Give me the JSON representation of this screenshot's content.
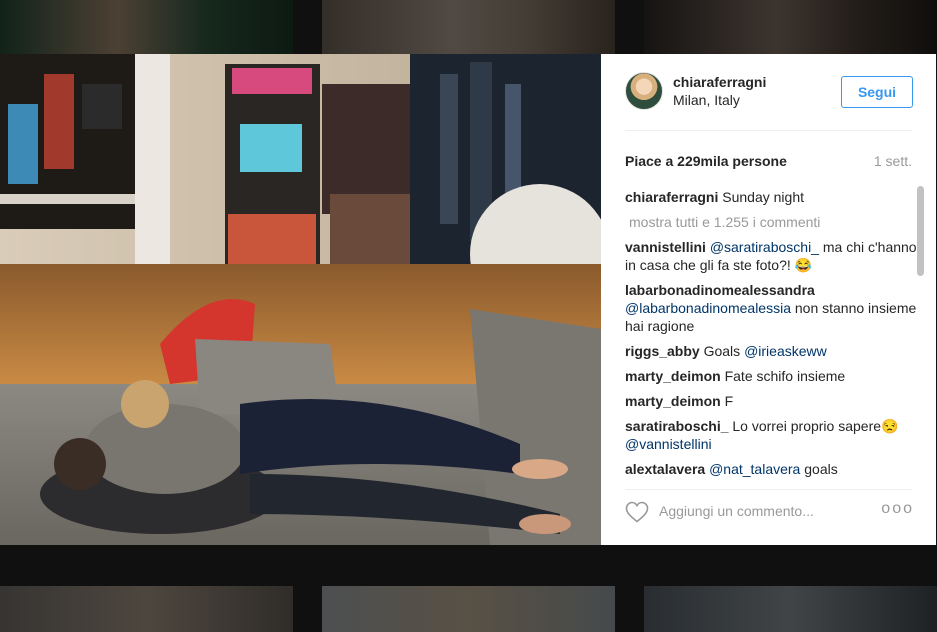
{
  "post": {
    "username": "chiaraferragni",
    "location": "Milan, Italy",
    "follow_label": "Segui",
    "likes": "Piace a 229mila persone",
    "time_ago": "1 sett.",
    "caption_user": "chiaraferragni",
    "caption_text": "Sunday night",
    "view_all": "mostra tutti e 1.255 i commenti",
    "add_comment_placeholder": "Aggiungi un commento...",
    "more_options": "ooo"
  },
  "comments": [
    {
      "user": "vannistellini",
      "mention": "@saratiraboschi_",
      "text": " ma chi c'hanno in casa che gli fa ste foto?! 😂"
    },
    {
      "user": "labarbonadinomealessandra",
      "mention": "@labarbonadinomealessia",
      "text": " non stanno insieme hai ragione"
    },
    {
      "user": "riggs_abby",
      "text": "Goals ",
      "mention": "@irieaskeww"
    },
    {
      "user": "marty_deimon",
      "text": "Fate schifo insieme"
    },
    {
      "user": "marty_deimon",
      "text": "F"
    },
    {
      "user": "saratiraboschi_",
      "text": "Lo vorrei proprio sapere😒 ",
      "mention": "@vannistellini"
    },
    {
      "user": "alextalavera",
      "mention": "@nat_talavera",
      "text": " goals"
    }
  ],
  "colors": {
    "accent": "#3897f0",
    "mention": "#003569",
    "text": "#262626",
    "muted": "#999999"
  },
  "icons": {
    "like": "heart-outline-icon",
    "options": "more-options-icon"
  }
}
